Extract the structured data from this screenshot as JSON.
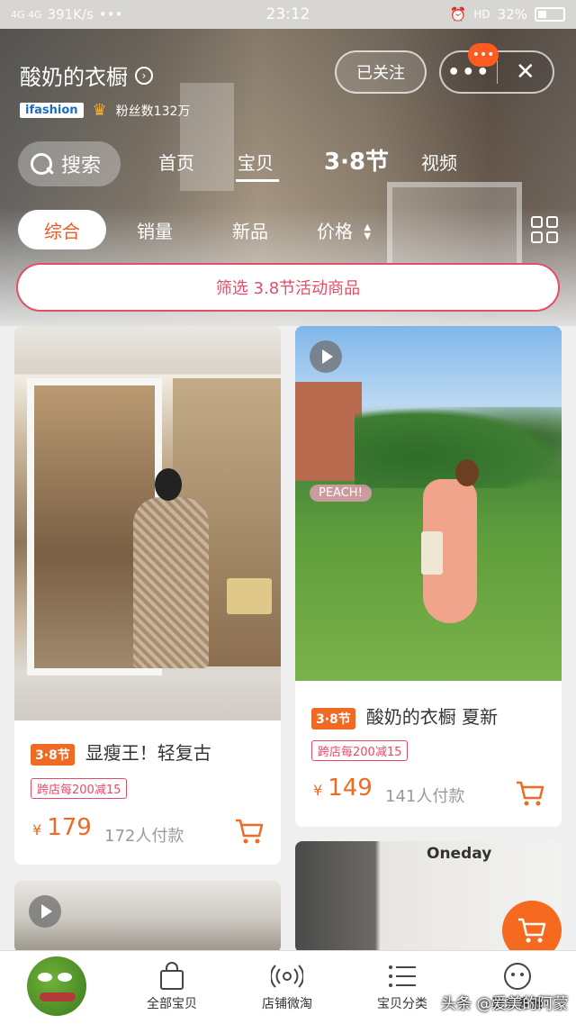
{
  "status_bar": {
    "network": "4G 4G",
    "speed": "391K/s",
    "more": "•••",
    "time": "23:12",
    "hd": "HD",
    "battery": "32%"
  },
  "header": {
    "shop_name": "酸奶的衣橱",
    "brand_badge": "ifashion",
    "fans": "粉丝数132万",
    "follow_label": "已关注",
    "more_badge": "•••",
    "close_label": "✕"
  },
  "nav": {
    "search_label": "搜索",
    "tabs": [
      "首页",
      "宝贝",
      "3·8节",
      "视频"
    ]
  },
  "sort": {
    "items": [
      "综合",
      "销量",
      "新品",
      "价格"
    ]
  },
  "filter_banner": "筛选 3.8节活动商品",
  "products": [
    {
      "tag": "3·8节",
      "title": "显瘦王！轻复古",
      "promo": "跨店每200减15",
      "yen": "¥",
      "price": "179",
      "sold": "172人付款"
    },
    {
      "tag": "3·8节",
      "title": "酸奶的衣橱 夏新",
      "promo": "跨店每200减15",
      "yen": "¥",
      "price": "149",
      "sold": "141人付款",
      "overlay_text": "PEACH!"
    },
    {
      "store_sign": "Oneday"
    }
  ],
  "bottom_nav": [
    {
      "label": "全部宝贝",
      "icon": "bag-icon"
    },
    {
      "label": "店铺微淘",
      "icon": "broadcast-icon"
    },
    {
      "label": "宝贝分类",
      "icon": "list-icon"
    },
    {
      "label": "联系客服",
      "icon": "chat-icon"
    }
  ],
  "watermark": "头条 @爱美的阿蒙",
  "colors": {
    "accent": "#f06a24",
    "promo": "#e84a6a"
  }
}
